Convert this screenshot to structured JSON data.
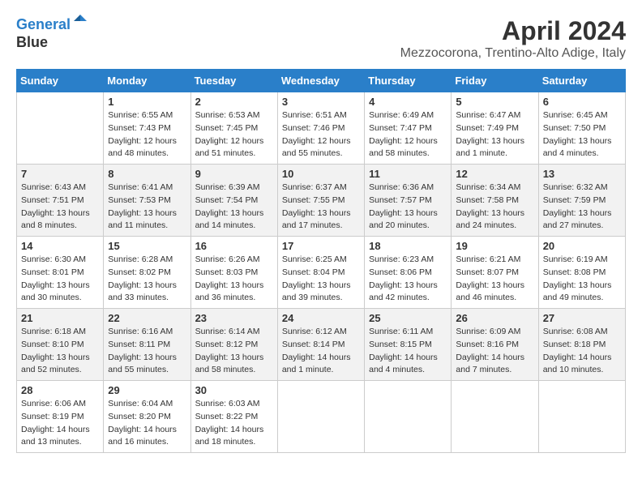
{
  "header": {
    "logo_line1": "General",
    "logo_line2": "Blue",
    "month_title": "April 2024",
    "location": "Mezzocorona, Trentino-Alto Adige, Italy"
  },
  "days_of_week": [
    "Sunday",
    "Monday",
    "Tuesday",
    "Wednesday",
    "Thursday",
    "Friday",
    "Saturday"
  ],
  "weeks": [
    [
      {
        "num": "",
        "info": ""
      },
      {
        "num": "1",
        "info": "Sunrise: 6:55 AM\nSunset: 7:43 PM\nDaylight: 12 hours\nand 48 minutes."
      },
      {
        "num": "2",
        "info": "Sunrise: 6:53 AM\nSunset: 7:45 PM\nDaylight: 12 hours\nand 51 minutes."
      },
      {
        "num": "3",
        "info": "Sunrise: 6:51 AM\nSunset: 7:46 PM\nDaylight: 12 hours\nand 55 minutes."
      },
      {
        "num": "4",
        "info": "Sunrise: 6:49 AM\nSunset: 7:47 PM\nDaylight: 12 hours\nand 58 minutes."
      },
      {
        "num": "5",
        "info": "Sunrise: 6:47 AM\nSunset: 7:49 PM\nDaylight: 13 hours\nand 1 minute."
      },
      {
        "num": "6",
        "info": "Sunrise: 6:45 AM\nSunset: 7:50 PM\nDaylight: 13 hours\nand 4 minutes."
      }
    ],
    [
      {
        "num": "7",
        "info": "Sunrise: 6:43 AM\nSunset: 7:51 PM\nDaylight: 13 hours\nand 8 minutes."
      },
      {
        "num": "8",
        "info": "Sunrise: 6:41 AM\nSunset: 7:53 PM\nDaylight: 13 hours\nand 11 minutes."
      },
      {
        "num": "9",
        "info": "Sunrise: 6:39 AM\nSunset: 7:54 PM\nDaylight: 13 hours\nand 14 minutes."
      },
      {
        "num": "10",
        "info": "Sunrise: 6:37 AM\nSunset: 7:55 PM\nDaylight: 13 hours\nand 17 minutes."
      },
      {
        "num": "11",
        "info": "Sunrise: 6:36 AM\nSunset: 7:57 PM\nDaylight: 13 hours\nand 20 minutes."
      },
      {
        "num": "12",
        "info": "Sunrise: 6:34 AM\nSunset: 7:58 PM\nDaylight: 13 hours\nand 24 minutes."
      },
      {
        "num": "13",
        "info": "Sunrise: 6:32 AM\nSunset: 7:59 PM\nDaylight: 13 hours\nand 27 minutes."
      }
    ],
    [
      {
        "num": "14",
        "info": "Sunrise: 6:30 AM\nSunset: 8:01 PM\nDaylight: 13 hours\nand 30 minutes."
      },
      {
        "num": "15",
        "info": "Sunrise: 6:28 AM\nSunset: 8:02 PM\nDaylight: 13 hours\nand 33 minutes."
      },
      {
        "num": "16",
        "info": "Sunrise: 6:26 AM\nSunset: 8:03 PM\nDaylight: 13 hours\nand 36 minutes."
      },
      {
        "num": "17",
        "info": "Sunrise: 6:25 AM\nSunset: 8:04 PM\nDaylight: 13 hours\nand 39 minutes."
      },
      {
        "num": "18",
        "info": "Sunrise: 6:23 AM\nSunset: 8:06 PM\nDaylight: 13 hours\nand 42 minutes."
      },
      {
        "num": "19",
        "info": "Sunrise: 6:21 AM\nSunset: 8:07 PM\nDaylight: 13 hours\nand 46 minutes."
      },
      {
        "num": "20",
        "info": "Sunrise: 6:19 AM\nSunset: 8:08 PM\nDaylight: 13 hours\nand 49 minutes."
      }
    ],
    [
      {
        "num": "21",
        "info": "Sunrise: 6:18 AM\nSunset: 8:10 PM\nDaylight: 13 hours\nand 52 minutes."
      },
      {
        "num": "22",
        "info": "Sunrise: 6:16 AM\nSunset: 8:11 PM\nDaylight: 13 hours\nand 55 minutes."
      },
      {
        "num": "23",
        "info": "Sunrise: 6:14 AM\nSunset: 8:12 PM\nDaylight: 13 hours\nand 58 minutes."
      },
      {
        "num": "24",
        "info": "Sunrise: 6:12 AM\nSunset: 8:14 PM\nDaylight: 14 hours\nand 1 minute."
      },
      {
        "num": "25",
        "info": "Sunrise: 6:11 AM\nSunset: 8:15 PM\nDaylight: 14 hours\nand 4 minutes."
      },
      {
        "num": "26",
        "info": "Sunrise: 6:09 AM\nSunset: 8:16 PM\nDaylight: 14 hours\nand 7 minutes."
      },
      {
        "num": "27",
        "info": "Sunrise: 6:08 AM\nSunset: 8:18 PM\nDaylight: 14 hours\nand 10 minutes."
      }
    ],
    [
      {
        "num": "28",
        "info": "Sunrise: 6:06 AM\nSunset: 8:19 PM\nDaylight: 14 hours\nand 13 minutes."
      },
      {
        "num": "29",
        "info": "Sunrise: 6:04 AM\nSunset: 8:20 PM\nDaylight: 14 hours\nand 16 minutes."
      },
      {
        "num": "30",
        "info": "Sunrise: 6:03 AM\nSunset: 8:22 PM\nDaylight: 14 hours\nand 18 minutes."
      },
      {
        "num": "",
        "info": ""
      },
      {
        "num": "",
        "info": ""
      },
      {
        "num": "",
        "info": ""
      },
      {
        "num": "",
        "info": ""
      }
    ]
  ]
}
